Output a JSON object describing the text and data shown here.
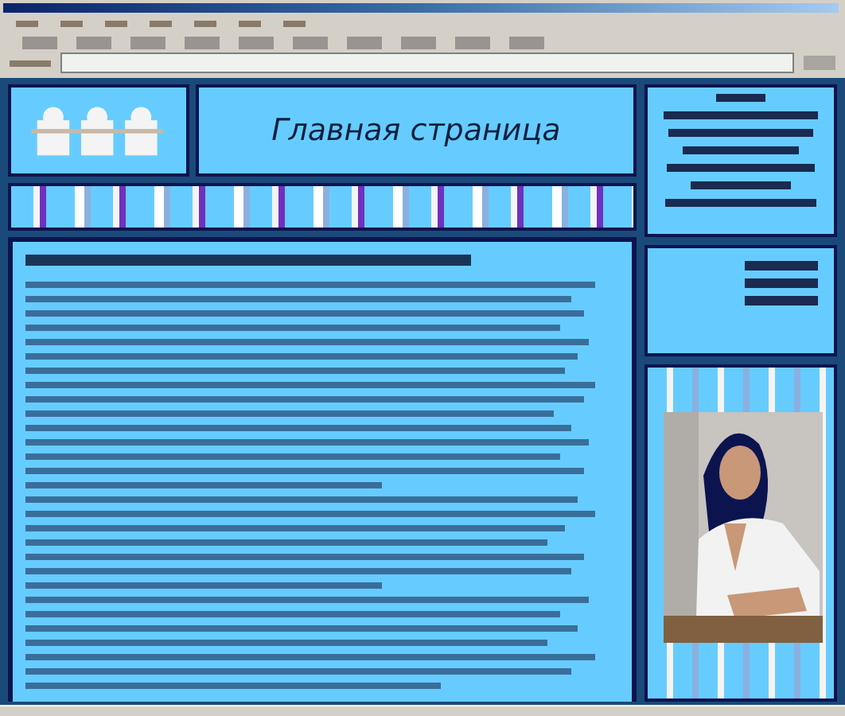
{
  "page": {
    "title": "Главная страница"
  }
}
